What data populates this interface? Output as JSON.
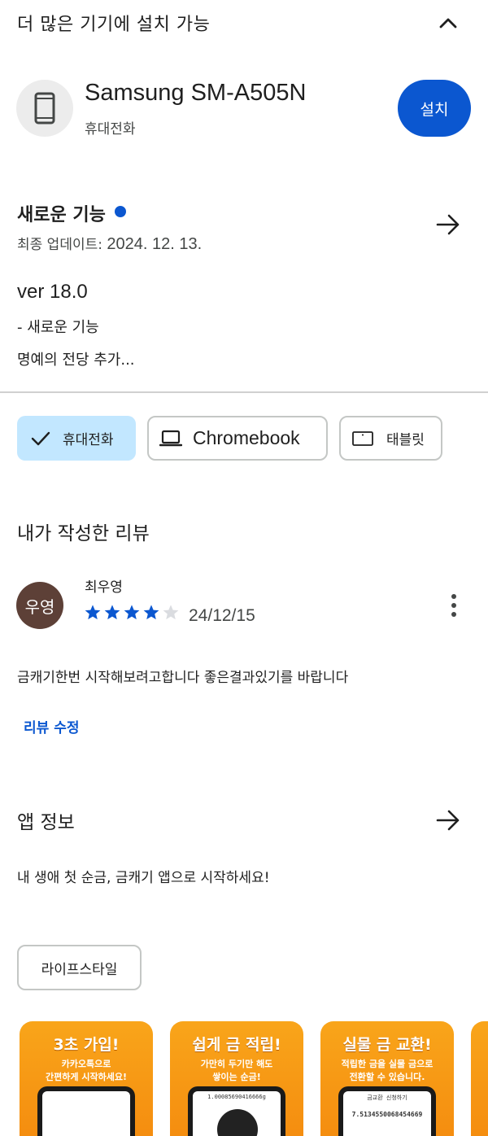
{
  "devices": {
    "header_title": "더 많은 기기에 설치 가능",
    "device_name": "Samsung SM-A505N",
    "device_type": "휴대전화",
    "install_label": "설치"
  },
  "whats_new": {
    "title": "새로운 기능",
    "last_update_label": "최종 업데이트:",
    "last_update_date": "2024. 12. 13.",
    "version": "ver 18.0",
    "note_line_1": "- 새로운 기능",
    "note_line_2": "명예의 전당 추가..."
  },
  "device_chips": {
    "phone": "휴대전화",
    "chromebook": "Chromebook",
    "tablet": "태블릿"
  },
  "my_review": {
    "title": "내가 작성한 리뷰",
    "avatar_text": "우영",
    "reviewer_name": "최우영",
    "rating": 4,
    "max_rating": 5,
    "date": "24/12/15",
    "text": "금캐기한번 시작해보려고합니다 좋은결과있기를 바랍니다",
    "edit_label": "리뷰 수정"
  },
  "app_info": {
    "title": "앱 정보",
    "description": "내 생애 첫 순금, 금캐기 앱으로 시작하세요!",
    "category": "라이프스타일"
  },
  "screenshots": [
    {
      "headline": "3초 가입!",
      "sub1": "카카오톡으로",
      "sub2": "간편하게 시작하세요!",
      "screen1": "",
      "screen2": ""
    },
    {
      "headline": "쉽게 금 적립!",
      "sub1": "가만히 두기만 해도",
      "sub2": "쌓이는 순금!",
      "screen1": "1.00085690416666g",
      "screen2": ""
    },
    {
      "headline": "실물 금 교환!",
      "sub1": "적립한 금을 실물 금으로",
      "sub2": "전환할 수 있습니다.",
      "screen1": "금교환 신청하기",
      "screen2": "7.5134550068454669"
    }
  ],
  "colors": {
    "accent": "#0b57d0",
    "chip_selected": "#c2e7ff",
    "star_filled": "#0b57d0",
    "star_empty": "#dadce0",
    "avatar_bg": "#5d4037",
    "screenshot_orange": "#f9a51a"
  }
}
